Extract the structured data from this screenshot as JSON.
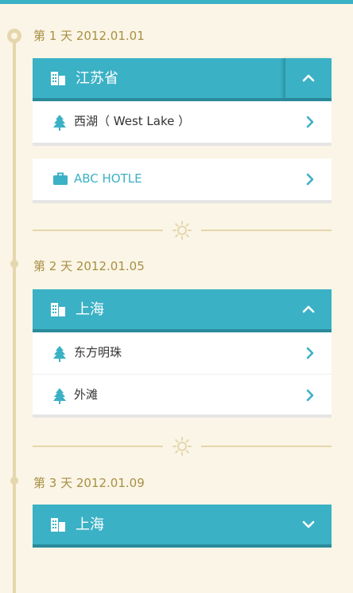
{
  "colors": {
    "accent": "#3bb1c5",
    "timeline": "#e6d6ad",
    "day_text": "#a98f45",
    "background": "#faf5e6"
  },
  "days": [
    {
      "label": "第 1 天 2012.01.01",
      "province": "江苏省",
      "toggle_icon": "chevron-up-icon",
      "places": [
        "西湖（ West Lake ）"
      ],
      "hotel": "ABC HOTLE"
    },
    {
      "label": "第 2 天 2012.01.05",
      "province": "上海",
      "toggle_icon": "chevron-up-icon",
      "places": [
        "东方明珠",
        "外滩"
      ]
    },
    {
      "label": "第 3 天 2012.01.09",
      "province": "上海",
      "toggle_icon": "chevron-down-icon",
      "places": []
    }
  ]
}
